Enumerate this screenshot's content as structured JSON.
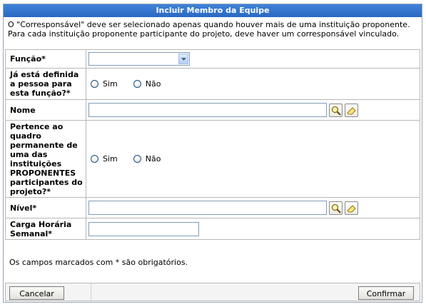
{
  "dialog": {
    "title": "Incluir Membro da Equipe",
    "note": "O \"Corresponsável\" deve ser selecionado apenas quando houver mais de uma instituição proponente. Para cada instituição proponente participante do projeto, deve haver um corresponsável vinculado."
  },
  "fields": {
    "funcao": {
      "label": "Função*",
      "value": ""
    },
    "definida": {
      "label": "Já está definida a pessoa para esta função?*",
      "opt_yes": "Sim",
      "opt_no": "Não"
    },
    "nome": {
      "label": "Nome",
      "value": ""
    },
    "quadro": {
      "label": "Pertence ao quadro permanente de uma das instituições PROPONENTES participantes do projeto?*",
      "opt_yes": "Sim",
      "opt_no": "Não"
    },
    "nivel": {
      "label": "Nível*",
      "value": ""
    },
    "carga": {
      "label": "Carga Horária Semanal*",
      "value": ""
    }
  },
  "required_note": "Os campos marcados com * são obrigatórios.",
  "buttons": {
    "cancel": "Cancelar",
    "confirm": "Confirmar"
  },
  "colors": {
    "title_bar": "#2f72cf",
    "border": "#b8b8b8"
  },
  "icons": {
    "search": "magnifier-icon",
    "clear": "eraser-icon"
  }
}
